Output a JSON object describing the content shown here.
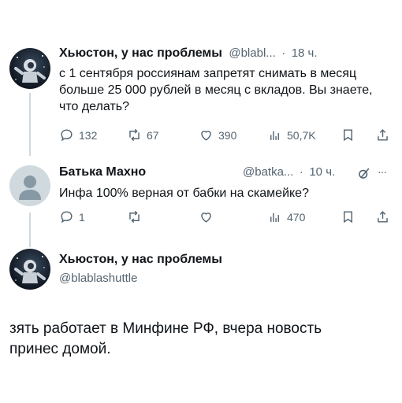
{
  "tweet1": {
    "name": "Хьюстон, у нас проблемы",
    "handle": "@blabl...",
    "sep": "·",
    "time": "18 ч.",
    "text": "с 1 сентября россиянам запретят снимать в месяц больше 25 000 рублей в месяц с вкладов. Вы знаете, что делать?",
    "replies": "132",
    "reposts": "67",
    "likes": "390",
    "views": "50,7K"
  },
  "tweet2": {
    "name": "Батька Махно",
    "handle": "@batka...",
    "sep": "·",
    "time": "10 ч.",
    "more": "···",
    "text": "Инфа 100% верная от бабки на скамейке?",
    "replies": "1",
    "views": "470"
  },
  "main": {
    "name": "Хьюстон, у нас проблемы",
    "handle": "@blablashuttle",
    "text": "зять работает в Минфине РФ, вчера новость принес домой."
  },
  "icons": [
    "reply-icon",
    "repost-icon",
    "like-icon",
    "views-icon",
    "bookmark-icon",
    "share-icon",
    "grok-icon",
    "more-icon"
  ]
}
